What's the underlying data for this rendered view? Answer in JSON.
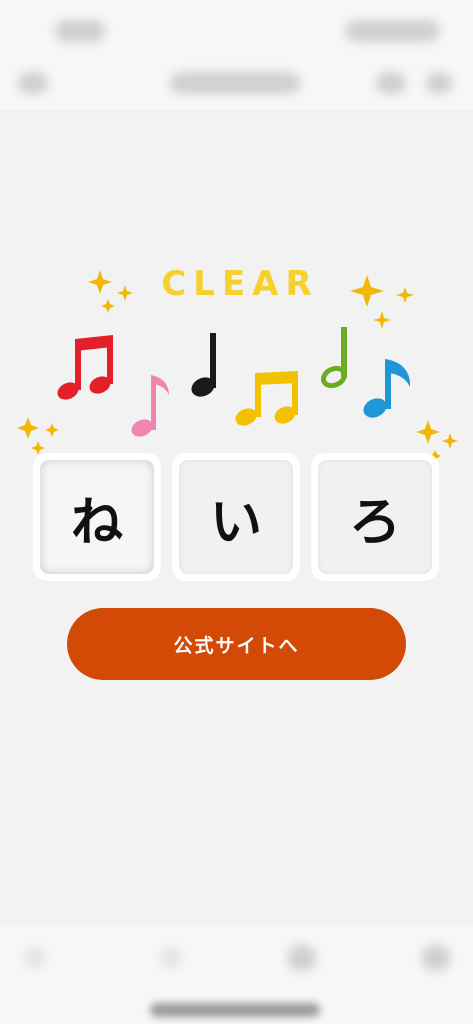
{
  "status_bar": {
    "time_icon": "time-blurred",
    "signal_icon": "status-icons-blurred"
  },
  "nav_bar": {
    "back_icon": "back-icon",
    "title_icon": "title-blurred",
    "share_icon": "share-icon",
    "more_icon": "more-icon"
  },
  "game": {
    "clear_text": "CLEAR",
    "tiles": [
      {
        "char": "ね"
      },
      {
        "char": "い"
      },
      {
        "char": "ろ"
      }
    ],
    "cta_label": "公式サイトへ"
  },
  "colors": {
    "accent": "#d24a05",
    "clear_yellow": "#f6d02c",
    "note_red": "#e3202a",
    "note_pink": "#ef86b2",
    "note_black": "#1a1a1a",
    "note_yellow": "#f2c200",
    "note_green": "#6aac22",
    "note_blue": "#1f96d6"
  },
  "tab_bar": {
    "icons": [
      "back-icon",
      "forward-icon",
      "tabs-icon",
      "menu-icon"
    ]
  }
}
